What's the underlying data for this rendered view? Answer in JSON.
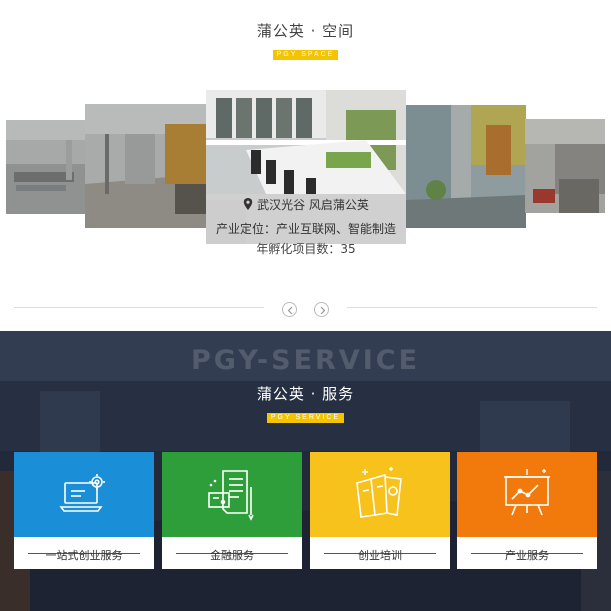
{
  "space": {
    "title": "蒲公英 · 空间",
    "subtitle": "PGY SPACE",
    "featured": {
      "location": "武汉光谷 风启蒲公英",
      "positioning": "产业定位：产业互联网、智能制造",
      "incubation": "年孵化项目数：35"
    },
    "nav": {
      "prev": "previous",
      "next": "next"
    }
  },
  "service": {
    "watermark": "PGY-SERVICE",
    "title": "蒲公英 · 服务",
    "subtitle": "PGY SERVICE",
    "cards": [
      {
        "label": "一站式创业服务",
        "icon": "laptop-gear-icon",
        "color": "#1a8ed6"
      },
      {
        "label": "金融服务",
        "icon": "document-card-icon",
        "color": "#2e9e3a"
      },
      {
        "label": "创业培训",
        "icon": "books-icon",
        "color": "#f7c21c"
      },
      {
        "label": "产业服务",
        "icon": "chart-board-icon",
        "color": "#f27a0c"
      }
    ]
  },
  "colors": {
    "accent": "#f5c400",
    "dark_bg": "#2a3345"
  }
}
